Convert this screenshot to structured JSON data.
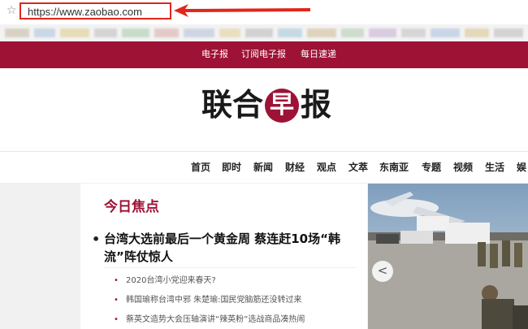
{
  "browser": {
    "url": "https://www.zaobao.com"
  },
  "topbar": {
    "links": [
      "电子报",
      "订阅电子报",
      "每日速递"
    ]
  },
  "logo": {
    "chars": [
      "联",
      "合",
      "早",
      "报"
    ]
  },
  "nav": {
    "items": [
      "首页",
      "即时",
      "新闻",
      "财经",
      "观点",
      "文萃",
      "东南亚",
      "专题",
      "视频",
      "生活",
      "娱"
    ]
  },
  "focus": {
    "title": "今日焦点",
    "headline": "台湾大选前最后一个黄金周 蔡连赶10场“韩流”阵仗惊人",
    "sub_items": [
      "2020台湾小党迎来春天?",
      "韩国瑜称台湾中邪 朱楚瑜:国民党脑筋还没转过来",
      "蔡英文造势大会压轴演讲“辣英粉”选战商品凑热闹"
    ]
  },
  "carousel": {
    "prev_symbol": "<"
  },
  "icons": {
    "bookmark": "star-icon",
    "annotation": "red-arrow-icon"
  },
  "colors": {
    "brand": "#9e1236",
    "annotation_red": "#e0261b"
  }
}
